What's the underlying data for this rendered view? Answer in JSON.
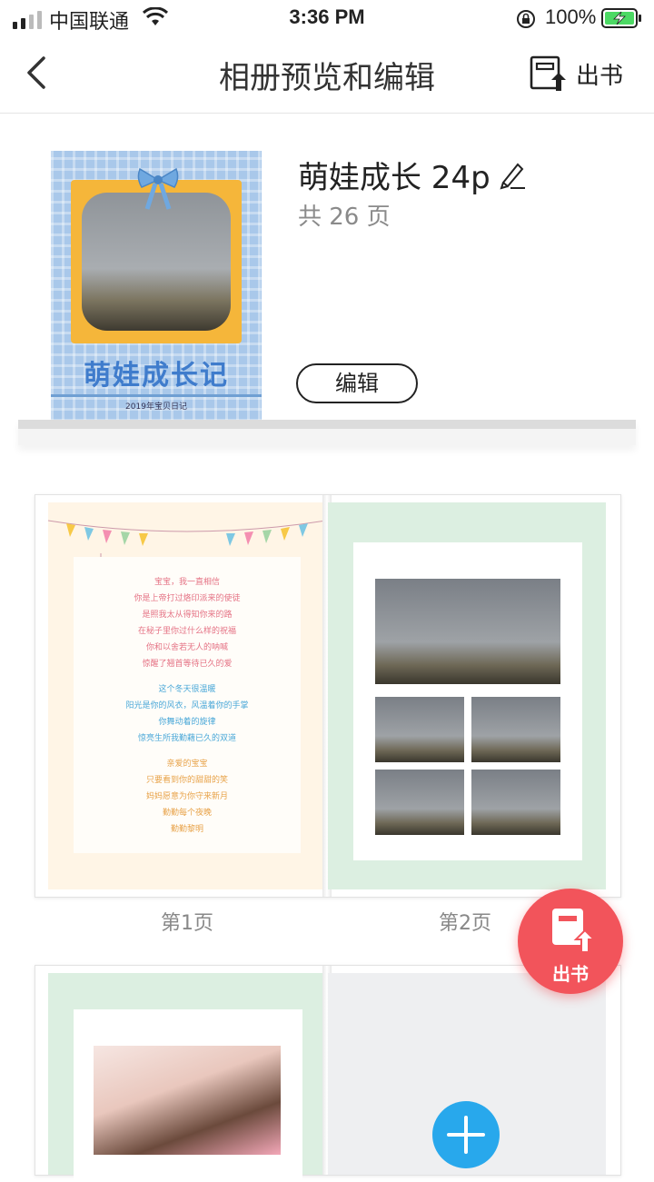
{
  "status": {
    "carrier": "中国联通",
    "time": "3:36 PM",
    "battery": "100%"
  },
  "nav": {
    "title": "相册预览和编辑",
    "publish_label": "出书"
  },
  "album": {
    "name": "萌娃成长 24p",
    "page_count": "共 26 页",
    "edit_label": "编辑",
    "cover_title": "萌娃成长记",
    "cover_footer": "2019年宝贝日记"
  },
  "poem": {
    "lines_a": [
      "宝宝，我一直相信",
      "你是上帝打过烙印派来的使徒",
      "是照我太从得知你来的路",
      "在秘子里你过什么样的祝福",
      "你和以舍若无人的呐喊",
      "惊醒了翘首等待已久的爱"
    ],
    "lines_b": [
      "这个冬天很温暖",
      "阳光是你的风衣，风温着你的手掌",
      "你舞动着的旋律",
      "惊亮生所我勤藉已久的双道"
    ],
    "lines_c": [
      "亲爱的宝宝",
      "只要看到你的甜甜的笑",
      "妈妈愿意为你守来新月",
      "勤勤每个夜晚",
      "勤勤黎明"
    ]
  },
  "pages": {
    "page1_label": "第1页",
    "page2_label": "第2页"
  },
  "fab": {
    "label": "出书"
  },
  "colors": {
    "accent_red": "#f2545b",
    "accent_blue": "#28a8ec",
    "cover_blue": "#a9c8ea",
    "cover_orange": "#f5b63a"
  }
}
